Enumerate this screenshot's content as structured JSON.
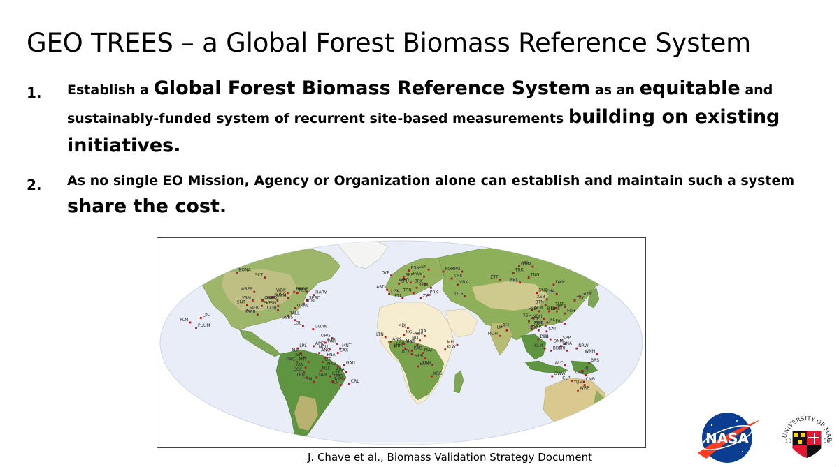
{
  "title": "GEO TREES – a Global Forest Biomass Reference System",
  "points": [
    {
      "num": "1.",
      "t1": "Establish a ",
      "t2": "Global Forest Biomass Reference System",
      "t3": " as an ",
      "t4": "equitable",
      "t5": " and sustainably-funded system of recurrent site-based measurements ",
      "t6": "building on existing initiatives."
    },
    {
      "num": "2.",
      "t1": "As no single EO Mission, Agency or Organization alone can establish and maintain such a system ",
      "t2": "share the cost."
    }
  ],
  "map": {
    "sites": [
      {
        "code": "BONA",
        "lon": -148,
        "lat": 65
      },
      {
        "code": "SCT",
        "lon": -120,
        "lat": 60
      },
      {
        "code": "UNDE",
        "lon": -89,
        "lat": 46
      },
      {
        "code": "WBK",
        "lon": -94,
        "lat": 45
      },
      {
        "code": "HLB",
        "lon": -86,
        "lat": 45
      },
      {
        "code": "BTW",
        "lon": -78,
        "lat": 46
      },
      {
        "code": "HARV",
        "lon": -72,
        "lat": 43
      },
      {
        "code": "WREF",
        "lon": -122,
        "lat": 46
      },
      {
        "code": "NIWO",
        "lon": -105,
        "lat": 41
      },
      {
        "code": "MCH",
        "lon": -92,
        "lat": 40
      },
      {
        "code": "SERC",
        "lon": -76,
        "lat": 38
      },
      {
        "code": "YSM",
        "lon": -120,
        "lat": 38
      },
      {
        "code": "ONAQ",
        "lon": -112,
        "lat": 38
      },
      {
        "code": "NSR",
        "lon": -100,
        "lat": 38
      },
      {
        "code": "SCBI",
        "lon": -78,
        "lat": 35
      },
      {
        "code": "SNT",
        "lon": -123,
        "lat": 34
      },
      {
        "code": "PKS",
        "lon": -111,
        "lat": 33
      },
      {
        "code": "TSN",
        "lon": -98,
        "lat": 33
      },
      {
        "code": "SJER",
        "lon": -121,
        "lat": 29
      },
      {
        "code": "CLBJ",
        "lon": -97,
        "lat": 29
      },
      {
        "code": "ORNL",
        "lon": -84,
        "lat": 31
      },
      {
        "code": "SRER",
        "lon": -112,
        "lat": 25
      },
      {
        "code": "TALL",
        "lon": -88,
        "lat": 24
      },
      {
        "code": "OSBS",
        "lon": -82,
        "lat": 20
      },
      {
        "code": "LPH",
        "lon": -155,
        "lat": 22
      },
      {
        "code": "PLM",
        "lon": -162,
        "lat": 18
      },
      {
        "code": "PUUM",
        "lon": -156,
        "lat": 13
      },
      {
        "code": "LOL",
        "lon": -75,
        "lat": 15
      },
      {
        "code": "GUAN",
        "lon": -67,
        "lat": 12
      },
      {
        "code": "ORG",
        "lon": -52,
        "lat": 4
      },
      {
        "code": "BAF",
        "lon": -57,
        "lat": 0
      },
      {
        "code": "FAR",
        "lon": -48,
        "lat": -1
      },
      {
        "code": "MNT",
        "lon": -46,
        "lat": -5
      },
      {
        "code": "NCU",
        "lon": -54,
        "lat": -6
      },
      {
        "code": "LPL",
        "lon": -78,
        "lat": -5
      },
      {
        "code": "ALP",
        "lon": -76,
        "lat": -9
      },
      {
        "code": "AMZ",
        "lon": -66,
        "lat": -3
      },
      {
        "code": "JEN",
        "lon": -74,
        "lat": -13
      },
      {
        "code": "ANC",
        "lon": -62,
        "lat": -9
      },
      {
        "code": "RAC",
        "lon": -80,
        "lat": -17
      },
      {
        "code": "CAX",
        "lon": -48,
        "lat": -9
      },
      {
        "code": "ANT",
        "lon": -71,
        "lat": -17
      },
      {
        "code": "PNA",
        "lon": -58,
        "lat": -13
      },
      {
        "code": "YAN",
        "lon": -74,
        "lat": -22
      },
      {
        "code": "LTC",
        "lon": -60,
        "lat": -17
      },
      {
        "code": "CCC",
        "lon": -76,
        "lat": -26
      },
      {
        "code": "NLK",
        "lon": -63,
        "lat": -25
      },
      {
        "code": "NXV",
        "lon": -49,
        "lat": -21
      },
      {
        "code": "GAU",
        "lon": -44,
        "lat": -20
      },
      {
        "code": "TRU",
        "lon": -75,
        "lat": -31
      },
      {
        "code": "TAM",
        "lon": -67,
        "lat": -31
      },
      {
        "code": "ARA",
        "lon": -43,
        "lat": -26
      },
      {
        "code": "CTT",
        "lon": -56,
        "lat": -30
      },
      {
        "code": "SMR",
        "lon": -45,
        "lat": -32
      },
      {
        "code": "ASS",
        "lon": -55,
        "lat": -35
      },
      {
        "code": "ILH",
        "lon": -49,
        "lat": -38
      },
      {
        "code": "CRL",
        "lon": -42,
        "lat": -37
      },
      {
        "code": "CHM",
        "lon": -70,
        "lat": -35
      },
      {
        "code": "BSN",
        "lon": 7,
        "lat": 67
      },
      {
        "code": "LSN",
        "lon": 25,
        "lat": 68
      },
      {
        "code": "KOM",
        "lon": 38,
        "lat": 66
      },
      {
        "code": "KRU",
        "lon": 55,
        "lat": 66
      },
      {
        "code": "ARX",
        "lon": 110,
        "lat": 72
      },
      {
        "code": "LRN",
        "lon": 122,
        "lat": 71
      },
      {
        "code": "TRK",
        "lon": 101,
        "lat": 65
      },
      {
        "code": "DYF",
        "lon": -9,
        "lat": 62
      },
      {
        "code": "SRE",
        "lon": 2,
        "lat": 60
      },
      {
        "code": "FWE",
        "lon": 20,
        "lat": 61
      },
      {
        "code": "TNG",
        "lon": 112,
        "lat": 60
      },
      {
        "code": "BKL",
        "lon": 102,
        "lat": 55
      },
      {
        "code": "DXN",
        "lon": 130,
        "lat": 53
      },
      {
        "code": "WEO",
        "lon": 8,
        "lat": 55
      },
      {
        "code": "KMS",
        "lon": 44,
        "lat": 59
      },
      {
        "code": "ZTT",
        "lon": 86,
        "lat": 58
      },
      {
        "code": "SPL",
        "lon": -2,
        "lat": 54
      },
      {
        "code": "BRK",
        "lon": 20,
        "lat": 54
      },
      {
        "code": "VNK",
        "lon": 48,
        "lat": 53
      },
      {
        "code": "ARD",
        "lon": -12,
        "lat": 48
      },
      {
        "code": "BLW",
        "lon": 13,
        "lat": 50
      },
      {
        "code": "PAL",
        "lon": 25,
        "lat": 50
      },
      {
        "code": "LGK",
        "lon": -10,
        "lat": 44
      },
      {
        "code": "TRN",
        "lon": 10,
        "lat": 45
      },
      {
        "code": "PRK",
        "lon": 22,
        "lat": 43
      },
      {
        "code": "PTI",
        "lon": 1,
        "lat": 40
      },
      {
        "code": "ZYE",
        "lon": 16,
        "lat": 40
      },
      {
        "code": "QTS",
        "lon": 52,
        "lat": 42
      },
      {
        "code": "DNG",
        "lon": 112,
        "lat": 45
      },
      {
        "code": "CHA",
        "lon": 128,
        "lat": 44
      },
      {
        "code": "GDW",
        "lon": 146,
        "lat": 42
      },
      {
        "code": "XSB",
        "lon": 118,
        "lat": 39
      },
      {
        "code": "TKY",
        "lon": 140,
        "lat": 38
      },
      {
        "code": "BTN",
        "lon": 115,
        "lat": 34
      },
      {
        "code": "GTN",
        "lon": 122,
        "lat": 31
      },
      {
        "code": "TNT",
        "lon": 130,
        "lat": 32
      },
      {
        "code": "ALM",
        "lon": 103,
        "lat": 29
      },
      {
        "code": "HSD",
        "lon": 108,
        "lat": 28
      },
      {
        "code": "DHS",
        "lon": 116,
        "lat": 28
      },
      {
        "code": "BTS",
        "lon": 122,
        "lat": 28
      },
      {
        "code": "FSH",
        "lon": 128,
        "lat": 26
      },
      {
        "code": "XSH",
        "lon": 102,
        "lat": 22
      },
      {
        "code": "BDP",
        "lon": 98,
        "lat": 19
      },
      {
        "code": "NDH",
        "lon": 110,
        "lat": 21
      },
      {
        "code": "JFL",
        "lon": 112,
        "lat": 18
      },
      {
        "code": "PAL",
        "lon": 125,
        "lat": 17
      },
      {
        "code": "KCR",
        "lon": 100,
        "lat": 15
      },
      {
        "code": "MKG",
        "lon": 110,
        "lat": 15
      },
      {
        "code": "YLI",
        "lon": 76,
        "lat": 14
      },
      {
        "code": "UPP",
        "lon": 80,
        "lat": 11
      },
      {
        "code": "SKR",
        "lon": 99,
        "lat": 12
      },
      {
        "code": "HKK",
        "lon": 104,
        "lat": 11
      },
      {
        "code": "CAT",
        "lon": 110,
        "lat": 10
      },
      {
        "code": "MDH",
        "lon": 74,
        "lat": 6
      },
      {
        "code": "PSH",
        "lon": 103,
        "lat": 3
      },
      {
        "code": "LMB",
        "lon": 112,
        "lat": 3
      },
      {
        "code": "SPP",
        "lon": 120,
        "lat": 2
      },
      {
        "code": "DNM",
        "lon": 123,
        "lat": -1
      },
      {
        "code": "DNA",
        "lon": 120,
        "lat": -3
      },
      {
        "code": "KLM",
        "lon": 108,
        "lat": -5
      },
      {
        "code": "BDR",
        "lon": 113,
        "lat": -7
      },
      {
        "code": "SRI",
        "lon": 125,
        "lat": -7
      },
      {
        "code": "NRW",
        "lon": 132,
        "lat": -5
      },
      {
        "code": "WNN",
        "lon": 148,
        "lat": -10
      },
      {
        "code": "BRS",
        "lon": 144,
        "lat": -18
      },
      {
        "code": "ALC",
        "lon": 126,
        "lat": -20
      },
      {
        "code": "INJ",
        "lon": 141,
        "lat": -25
      },
      {
        "code": "KRW",
        "lon": 145,
        "lat": -29
      },
      {
        "code": "GWW",
        "lon": 119,
        "lat": -30
      },
      {
        "code": "CLP",
        "lon": 136,
        "lat": -34
      },
      {
        "code": "CMB",
        "lon": 146,
        "lat": -35
      },
      {
        "code": "TUM",
        "lon": 148,
        "lat": -38
      },
      {
        "code": "WRR",
        "lon": 145,
        "lat": -43
      },
      {
        "code": "MDJ",
        "lon": 5,
        "lat": 13
      },
      {
        "code": "DJA",
        "lon": 12,
        "lat": 8
      },
      {
        "code": "LTN",
        "lon": -12,
        "lat": 5
      },
      {
        "code": "NGL",
        "lon": 2,
        "lat": 7
      },
      {
        "code": "MBK",
        "lon": 18,
        "lat": 6
      },
      {
        "code": "ANK",
        "lon": -8,
        "lat": 1
      },
      {
        "code": "LND",
        "lon": 14,
        "lat": 2
      },
      {
        "code": "MNG",
        "lon": 2,
        "lat": -1
      },
      {
        "code": "ERG",
        "lon": 12,
        "lat": -2
      },
      {
        "code": "LOP",
        "lon": -5,
        "lat": -3
      },
      {
        "code": "MBN",
        "lon": 3,
        "lat": -5
      },
      {
        "code": "RAB",
        "lon": 8,
        "lat": -7
      },
      {
        "code": "BTK",
        "lon": 8,
        "lat": -10
      },
      {
        "code": "MAI",
        "lon": 16,
        "lat": -9
      },
      {
        "code": "MLB",
        "lon": 18,
        "lat": -14
      },
      {
        "code": "KLW",
        "lon": 33,
        "lat": -6
      },
      {
        "code": "MPL",
        "lon": 42,
        "lat": -2
      },
      {
        "code": "BCR",
        "lon": 13,
        "lat": -21
      },
      {
        "code": "SRN",
        "lon": 24,
        "lat": -20
      },
      {
        "code": "KRG",
        "lon": 24,
        "lat": -30
      }
    ]
  },
  "citation": "J. Chave et al., Biomass Validation Strategy Document",
  "logos": {
    "nasa_text": "NASA",
    "umd_arc_text": "UNIVERSITY OF MARYLAND",
    "umd_year_left": "18",
    "umd_year_right": "56"
  }
}
